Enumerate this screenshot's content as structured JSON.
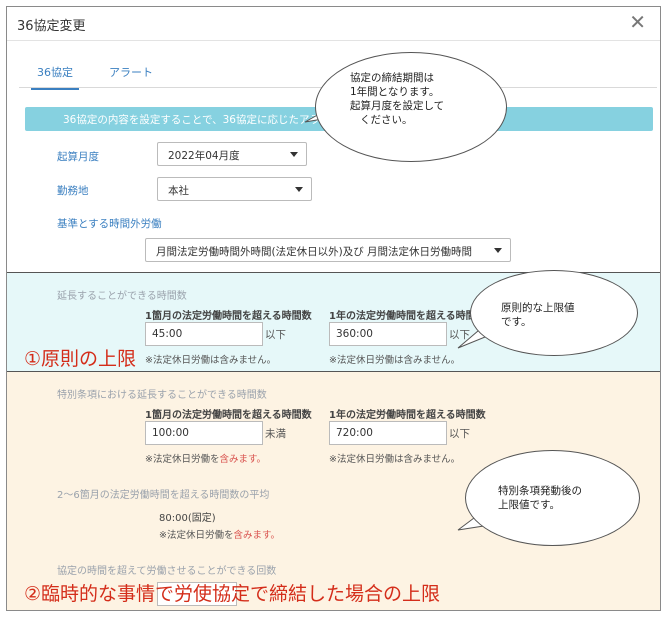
{
  "dialog": {
    "title": "36協定変更",
    "close_symbol": "✕"
  },
  "tabs": [
    {
      "label": "36協定",
      "active": true
    },
    {
      "label": "アラート",
      "active": false
    }
  ],
  "info_bar": "36協定の内容を設定することで、36協定に応じたアラー",
  "form": {
    "start_month": {
      "label": "起算月度",
      "value": "2022年04月度"
    },
    "workplace": {
      "label": "勤務地",
      "value": "本社"
    },
    "basis": {
      "label": "基準とする時間外労働",
      "value": "月間法定労働時間外時間(法定休日以外)及び 月間法定休日労働時間"
    }
  },
  "section_principle": {
    "heading": "延長することができる時間数",
    "monthly": {
      "label": "1箇月の法定労働時間を超える時間数",
      "value": "45:00",
      "suffix": "以下",
      "note": "※法定休日労働は含みません。"
    },
    "yearly": {
      "label": "1年の法定労働時間を超える時間数",
      "value": "360:00",
      "suffix": "以下",
      "note": "※法定休日労働は含みません。"
    },
    "caption": "①原則の上限"
  },
  "section_special": {
    "heading": "特別条項における延長することができる時間数",
    "monthly": {
      "label": "1箇月の法定労働時間を超える時間数",
      "value": "100:00",
      "suffix": "未満",
      "note_prefix": "※法定休日労働を",
      "note_red": "含みます。"
    },
    "yearly": {
      "label": "1年の法定労働時間を超える時間数",
      "value": "720:00",
      "suffix": "以下",
      "note": "※法定休日労働は含みません。"
    },
    "avg_heading": "2〜6箇月の法定労働時間を超える時間数の平均",
    "avg_value": "80:00(固定)",
    "avg_note_prefix": "※法定休日労働を",
    "avg_note_red": "含みます。",
    "count_heading": "協定の時間を超えて労働させることができる回数",
    "caption": "②臨時的な事情で労使協定で締結した場合の上限"
  },
  "callouts": {
    "period": [
      "協定の締結期間は",
      "1年間となります。",
      "起算月度を設定して",
      "ください。"
    ],
    "principle": [
      "原則的な上限値",
      "です。"
    ],
    "special": [
      "特別条項発動後の",
      "上限値です。"
    ]
  },
  "colors": {
    "accent": "#3a7fc0",
    "info_bar": "#86d1e0",
    "caption_red": "#d42d1a",
    "sec1_bg": "#e6f8f9",
    "sec2_bg": "#fdf3e3"
  }
}
